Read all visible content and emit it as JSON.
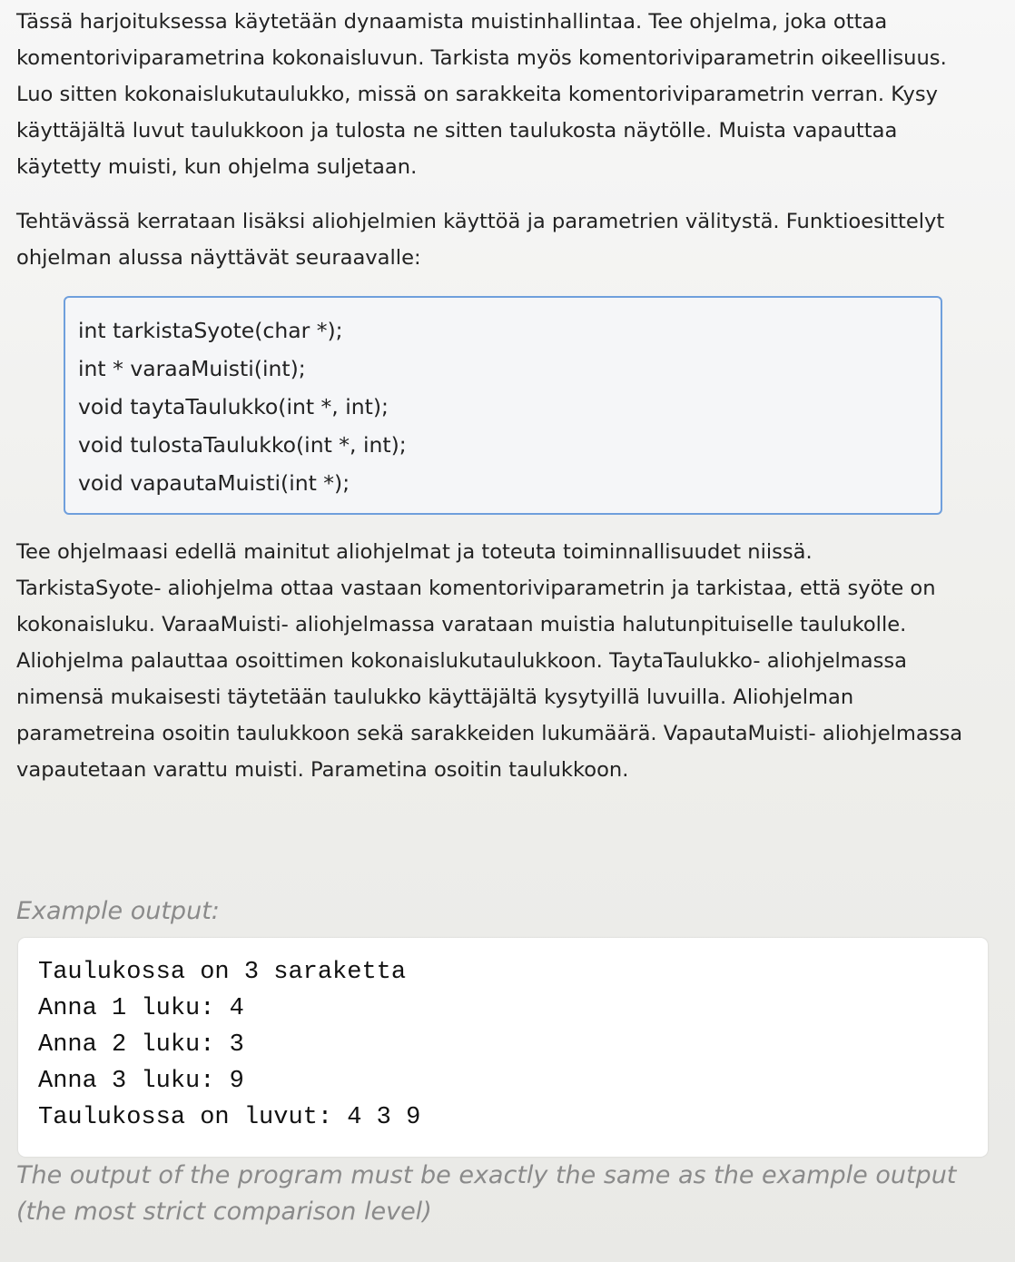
{
  "intro": {
    "paragraph1": [
      "Tässä harjoituksessa käytetään dynaamista muistinhallintaa. Tee ohjelma, joka ottaa",
      "komentoriviparametrina kokonaisluvun. Tarkista myös komentoriviparametrin oikeellisuus.",
      "Luo sitten kokonaislukutaulukko, missä on sarakkeita komentoriviparametrin verran. Kysy",
      "käyttäjältä luvut taulukkoon ja tulosta ne sitten taulukosta näytölle. Muista vapauttaa",
      "käytetty muisti, kun ohjelma suljetaan."
    ],
    "paragraph2": [
      "Tehtävässä kerrataan lisäksi aliohjelmien käyttöä ja parametrien välitystä. Funktioesittelyt",
      "ohjelman alussa näyttävät seuraavalle:"
    ]
  },
  "code": [
    "int tarkistaSyote(char *);",
    "int * varaaMuisti(int);",
    "void taytaTaulukko(int *, int);",
    "void tulostaTaulukko(int *, int);",
    "void vapautaMuisti(int *);"
  ],
  "description": [
    "Tee ohjelmaasi edellä mainitut aliohjelmat ja toteuta toiminnallisuudet niissä.",
    "TarkistaSyote- aliohjelma ottaa vastaan komentoriviparametrin ja tarkistaa, että syöte on",
    "kokonaisluku. VaraaMuisti- aliohjelmassa varataan muistia halutunpituiselle taulukolle.",
    "Aliohjelma palauttaa osoittimen kokonaislukutaulukkoon. TaytaTaulukko- aliohjelmassa",
    "nimensä mukaisesti täytetään taulukko käyttäjältä kysytyillä luvuilla. Aliohjelman",
    "parametreina osoitin taulukkoon sekä sarakkeiden lukumäärä. VapautaMuisti- aliohjelmassa",
    "vapautetaan varattu muisti. Parametina osoitin taulukkoon."
  ],
  "example": {
    "label": "Example output:",
    "lines": [
      "Taulukossa on 3 saraketta",
      "Anna 1 luku: 4",
      "Anna 2 luku: 3",
      "Anna 3 luku: 9",
      "Taulukossa on luvut: 4 3 9"
    ]
  },
  "note": [
    "The output of the program must be exactly the same as the example output",
    "(the most strict comparison level)"
  ]
}
